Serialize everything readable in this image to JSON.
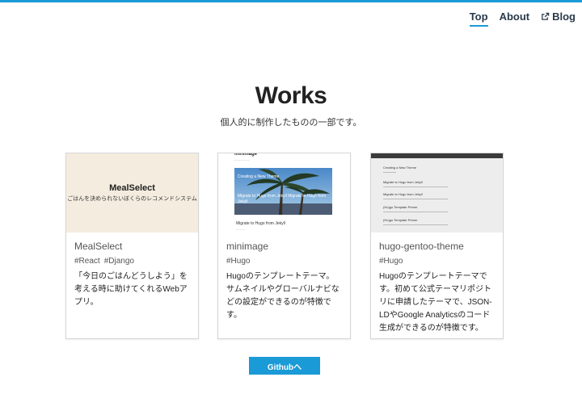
{
  "nav": {
    "items": [
      {
        "label": "Top",
        "active": true
      },
      {
        "label": "About",
        "active": false
      },
      {
        "label": "Blog",
        "active": false,
        "icon": "external-link-icon"
      }
    ]
  },
  "hero": {
    "title": "Works",
    "subtitle": "個人的に制作したものの一部です。"
  },
  "works": [
    {
      "title": "MealSelect",
      "tags": [
        "#React",
        "#Django"
      ],
      "description": "「今日のごはんどうしよう」を考える時に助けてくれるWebアプリ。",
      "thumb": {
        "title": "MealSelect",
        "subtitle": "ごはんを決められないぼくらのレコメンドシステム"
      }
    },
    {
      "title": "minimage",
      "tags": [
        "#Hugo"
      ],
      "description": "Hugoのテンプレートテーマ。サムネイルやグローバルナビなどの設定ができるのが特徴です。",
      "thumb": {
        "heading": "minimage",
        "overlay1": "Creating a New Theme",
        "overlay2": "Migrate to Hugo from Jekyll Migrate to Hugo from Jekyll",
        "footer": "Migrate to Hugo from Jekyll"
      }
    },
    {
      "title": "hugo-gentoo-theme",
      "tags": [
        "#Hugo"
      ],
      "description": "Hugoのテンプレートテーマです。初めて公式テーマリポジトリに申請したテーマで、JSON-LDやGoogle Analyticsのコード生成ができるのが特徴です。",
      "thumb": {
        "items": [
          "Creating a New Theme",
          "Migrate to Hugo from Jekyll",
          "Migrate to Hugo from Jekyll",
          "(Hu)go Template Primer",
          "(Hu)go Template Primer"
        ]
      }
    }
  ],
  "github_button": "Githubへ",
  "colors": {
    "accent": "#1a9ad6",
    "nav_text": "#2a3a4a",
    "thumb_mealselect_bg": "#f4ecdf"
  }
}
